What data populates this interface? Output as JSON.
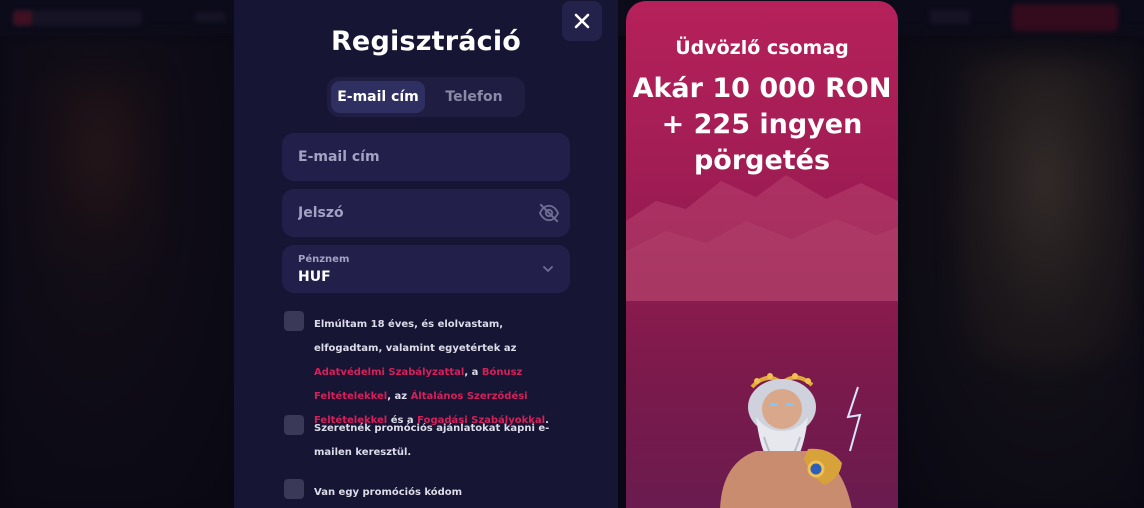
{
  "modal": {
    "title": "Regisztráció",
    "close_icon": "close-icon",
    "tabs": [
      {
        "label": "E-mail cím",
        "active": true
      },
      {
        "label": "Telefon",
        "active": false
      }
    ],
    "email_field": {
      "placeholder": "E-mail cím",
      "value": ""
    },
    "password_field": {
      "placeholder": "Jelszó",
      "value": "",
      "icon": "eye-off-icon"
    },
    "currency_select": {
      "label": "Pénznem",
      "value": "HUF",
      "icon": "chevron-down-icon"
    },
    "consent": {
      "part1": "Elmúltam 18 éves, és elolvastam, elfogadtam, valamint egyetértek az ",
      "link1": "Adatvédelmi Szabályzattal",
      "part2": ", a ",
      "link2": "Bónusz Feltételekkel",
      "part3": ", az ",
      "link3": "Általános Szerződési Feltételekkel",
      "part4": " és a ",
      "link4": "Fogadási Szabályokkal",
      "part5": ".",
      "checked": false
    },
    "promo_emails": {
      "label": "Szeretnék promóciós ajánlatokat kapni e-mailen keresztül.",
      "checked": false
    },
    "promo_code": {
      "label": "Van egy promóciós kódom",
      "checked": false
    }
  },
  "promo_panel": {
    "subtitle": "Üdvözlő csomag",
    "headline_line1": "Akár 10 000 RON",
    "headline_line2": "+ 225 ingyen",
    "headline_line3": "pörgetés"
  },
  "colors": {
    "modal_bg": "#161533",
    "field_bg": "#22204b",
    "accent_link": "#d6205a",
    "promo_bg": "#a41d55"
  }
}
